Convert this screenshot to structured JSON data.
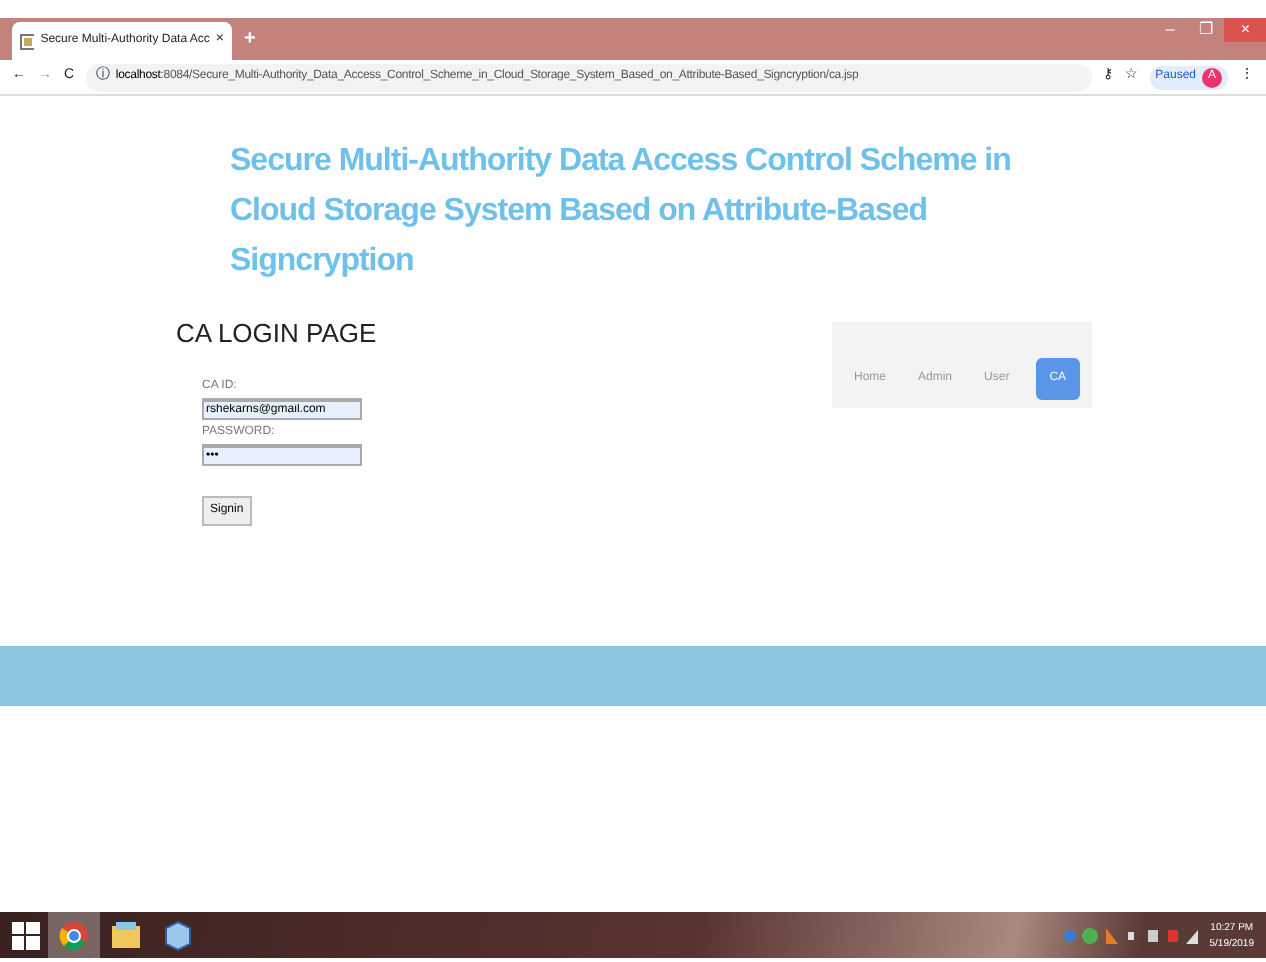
{
  "browser": {
    "tab_title": "Secure Multi-Authority Data Acc",
    "tab_close": "×",
    "new_tab": "+",
    "window_controls": [
      "–",
      "❐",
      "×"
    ],
    "nav_buttons": [
      "←",
      "→",
      "C"
    ],
    "info": "ⓘ",
    "key": "⚷",
    "star": "☆",
    "menu": "⋮",
    "url_host": "localhost",
    "url_path": ":8084/Secure_Multi-Authority_Data_Access_Control_Scheme_in_Cloud_Storage_System_Based_on_Attribute-Based_Signcryption/ca.jsp",
    "profile_label": "Paused",
    "profile_initial": "A"
  },
  "page": {
    "title": "Secure Multi-Authority Data Access Control Scheme in Cloud Storage System Based on Attribute-Based Signcryption",
    "heading": "CA LOGIN PAGE",
    "fields": [
      {
        "label": "CA ID:",
        "value": "rshekarns@gmail.com"
      },
      {
        "label": "PASSWORD:",
        "value": "•••"
      }
    ],
    "submit": "Signin",
    "nav": [
      {
        "label": "Home",
        "selected": false
      },
      {
        "label": "Admin",
        "selected": false
      },
      {
        "label": "User",
        "selected": false
      },
      {
        "label": "CA",
        "selected": true
      }
    ]
  },
  "taskbar": {
    "apps": [
      {
        "kind": "browser",
        "selected": true
      },
      {
        "kind": "folder",
        "selected": false
      },
      {
        "kind": "box",
        "selected": false
      }
    ],
    "time": "10:27 PM",
    "date": "5/19/2019"
  }
}
